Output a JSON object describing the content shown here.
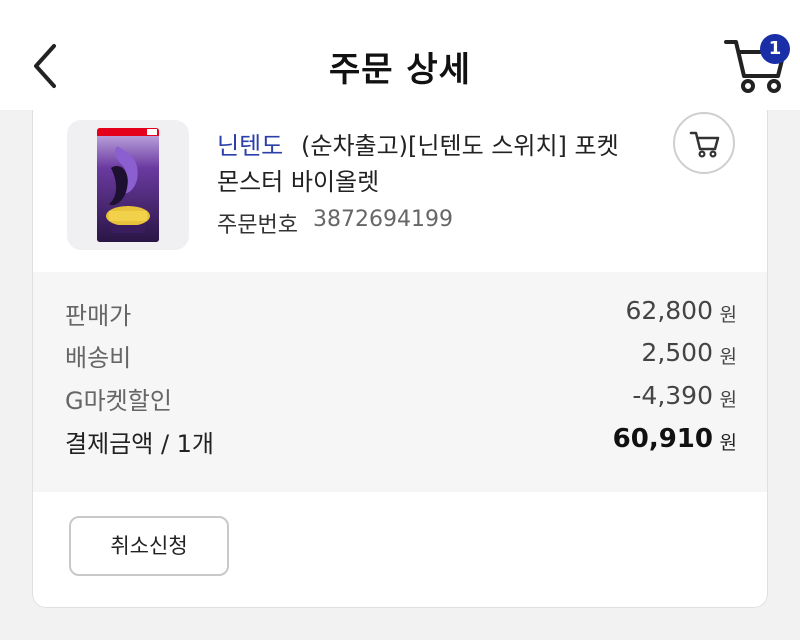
{
  "header": {
    "title": "주문 상세",
    "back_icon": "chevron-left-icon",
    "cart_icon": "cart-icon",
    "cart_count": "1"
  },
  "product": {
    "brand": "닌텐도",
    "name_line1": "(순차출고)[닌텐도 스위치] 포켓",
    "name_line2": "몬스터 바이올렛",
    "order_label": "주문번호",
    "order_number": "3872694199",
    "add_cart_icon": "cart-icon"
  },
  "pricing": {
    "rows": [
      {
        "label": "판매가",
        "value": "62,800",
        "unit": "원"
      },
      {
        "label": "배송비",
        "value": "2,500",
        "unit": "원"
      },
      {
        "label": "G마켓할인",
        "value": "-4,390",
        "unit": "원"
      }
    ],
    "total": {
      "label": "결제금액 / 1개",
      "value": "60,910",
      "unit": "원"
    }
  },
  "actions": {
    "cancel_label": "취소신청"
  },
  "colors": {
    "brand_link": "#2b3faa",
    "badge": "#1a2ea8",
    "page_bg": "#f2f2f2",
    "price_bg": "#f6f6f6"
  }
}
